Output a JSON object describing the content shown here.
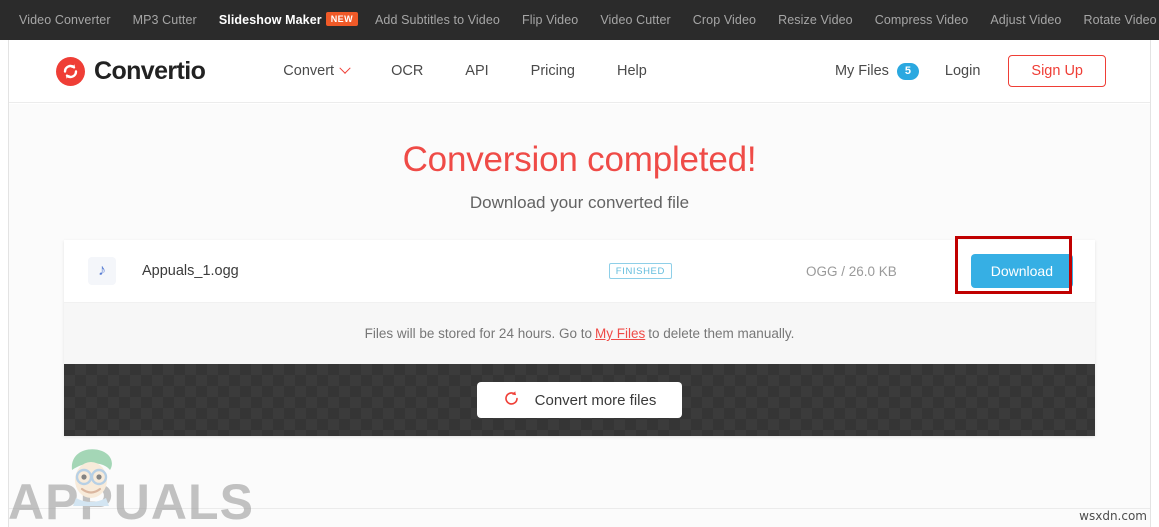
{
  "topnav": {
    "items": [
      {
        "label": "Video Converter",
        "active": false,
        "badge": null
      },
      {
        "label": "MP3 Cutter",
        "active": false,
        "badge": null
      },
      {
        "label": "Slideshow Maker",
        "active": true,
        "badge": "NEW"
      },
      {
        "label": "Add Subtitles to Video",
        "active": false,
        "badge": null
      },
      {
        "label": "Flip Video",
        "active": false,
        "badge": null
      },
      {
        "label": "Video Cutter",
        "active": false,
        "badge": null
      },
      {
        "label": "Crop Video",
        "active": false,
        "badge": null
      },
      {
        "label": "Resize Video",
        "active": false,
        "badge": null
      },
      {
        "label": "Compress Video",
        "active": false,
        "badge": null
      },
      {
        "label": "Adjust Video",
        "active": false,
        "badge": null
      },
      {
        "label": "Rotate Video",
        "active": false,
        "badge": null
      }
    ]
  },
  "header": {
    "brand_name": "Convertio",
    "brand_icon": "convertio-logo-icon",
    "nav": [
      {
        "label": "Convert",
        "has_dropdown": true
      },
      {
        "label": "OCR",
        "has_dropdown": false
      },
      {
        "label": "API",
        "has_dropdown": false
      },
      {
        "label": "Pricing",
        "has_dropdown": false
      },
      {
        "label": "Help",
        "has_dropdown": false
      }
    ],
    "my_files_label": "My Files",
    "my_files_count": "5",
    "login_label": "Login",
    "signup_label": "Sign Up"
  },
  "main": {
    "title": "Conversion completed!",
    "subtitle": "Download your converted file",
    "file": {
      "icon": "music-note-icon",
      "name": "Appuals_1.ogg",
      "status": "FINISHED",
      "meta": "OGG / 26.0 KB",
      "download_label": "Download"
    },
    "notice": {
      "before": "Files will be stored for 24 hours. Go to",
      "link": "My Files",
      "after": "to delete them manually."
    },
    "convert_more_label": "Convert more files",
    "convert_more_icon": "refresh-icon"
  },
  "watermarks": {
    "appuals": "APPUALS",
    "site": "wsxdn.com"
  },
  "colors": {
    "brand_red": "#ef3e36",
    "title_red": "#ef4b47",
    "download_blue": "#36afe4",
    "badge_blue": "#2aa8e0",
    "status_blue": "#63bcdd",
    "new_badge_orange": "#f05a28",
    "annotation_red": "#c00000",
    "topnav_dark": "#2b2b2b",
    "footer_dark": "#353535"
  }
}
